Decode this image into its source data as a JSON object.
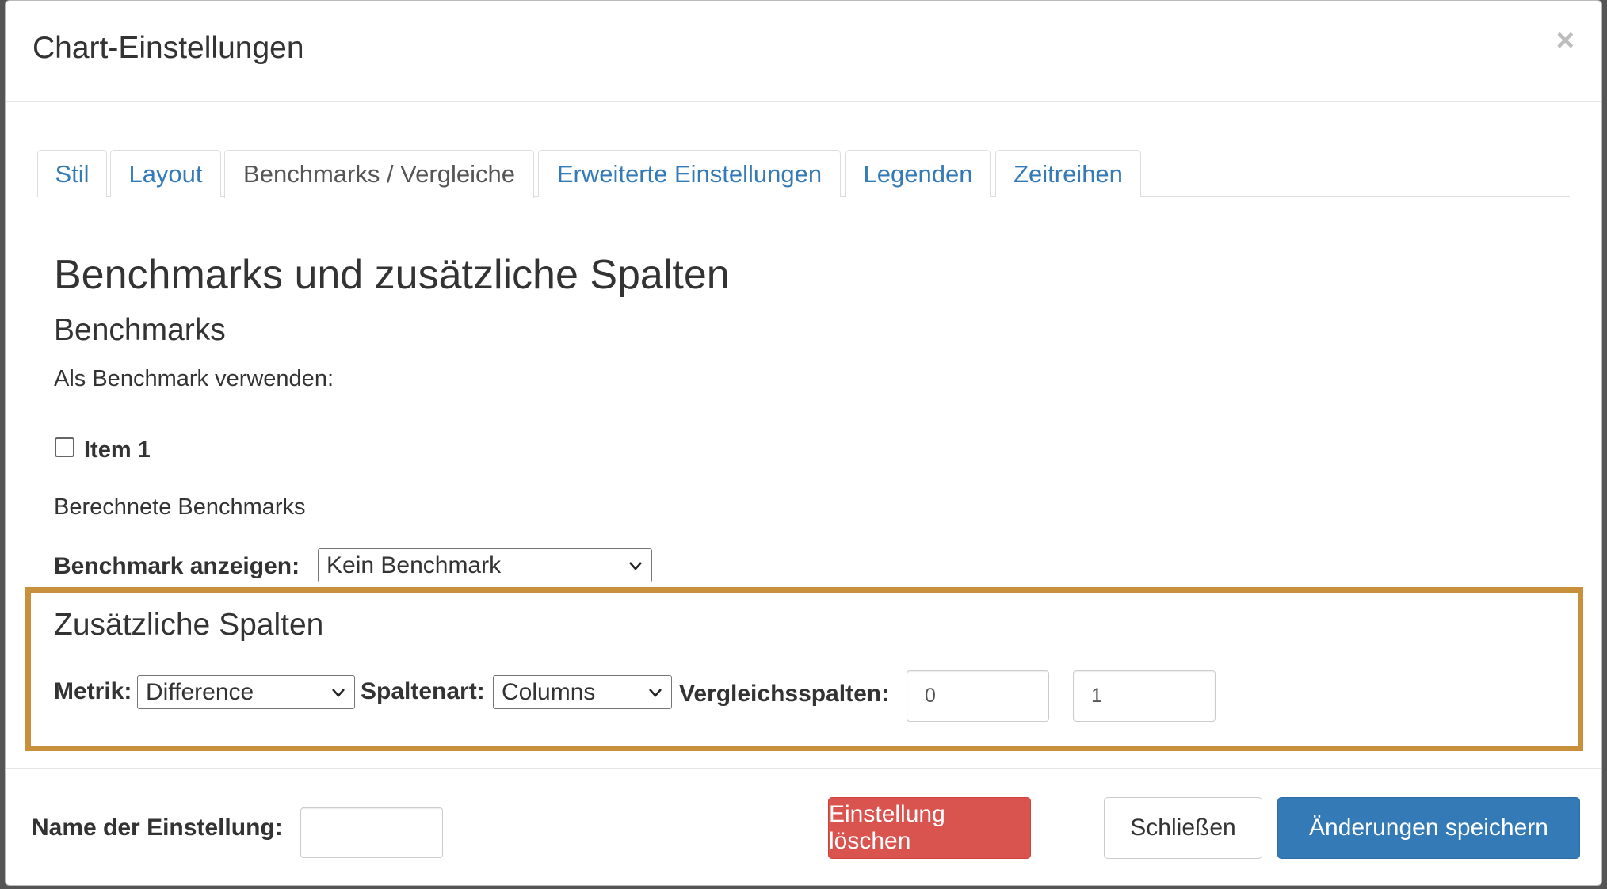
{
  "modal": {
    "title": "Chart-Einstellungen",
    "close_glyph": "×"
  },
  "tabs": [
    {
      "label": "Stil",
      "active": false
    },
    {
      "label": "Layout",
      "active": false
    },
    {
      "label": "Benchmarks / Vergleiche",
      "active": true
    },
    {
      "label": "Erweiterte Einstellungen",
      "active": false
    },
    {
      "label": "Legenden",
      "active": false
    },
    {
      "label": "Zeitreihen",
      "active": false
    }
  ],
  "content": {
    "heading": "Benchmarks und zusätzliche Spalten",
    "benchmarks_heading": "Benchmarks",
    "use_as_benchmark": "Als Benchmark verwenden:",
    "item1_label": "Item 1",
    "item1_checked": false,
    "computed_benchmarks": "Berechnete Benchmarks",
    "show_benchmark_label": "Benchmark anzeigen:",
    "show_benchmark_value": "Kein Benchmark"
  },
  "extra_columns": {
    "heading": "Zusätzliche Spalten",
    "metric_label": "Metrik:",
    "metric_value": "Difference",
    "column_type_label": "Spaltenart:",
    "column_type_value": "Columns",
    "compare_columns_label": "Vergleichsspalten:",
    "compare_col_1": "0",
    "compare_col_2": "1",
    "highlight_color": "#c8903b"
  },
  "footer": {
    "name_label": "Name der Einstellung:",
    "name_value": "",
    "delete_button": "Einstellung löschen",
    "close_button": "Schließen",
    "save_button": "Änderungen speichern"
  },
  "colors": {
    "link": "#337ab7",
    "danger": "#d9534f",
    "primary": "#337ab7"
  }
}
